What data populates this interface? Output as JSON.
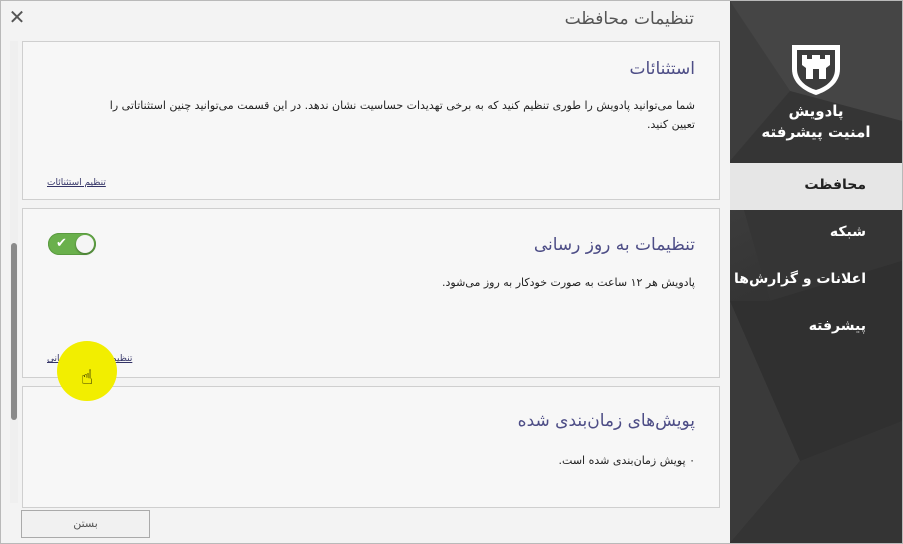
{
  "window": {
    "title": "تنظیمات محافظت",
    "close_glyph": "✕"
  },
  "brand": {
    "line1": "پادویش",
    "line2": "امنیت پیشرفته"
  },
  "nav": {
    "items": [
      {
        "label": "محافظت",
        "active": true
      },
      {
        "label": "شبکه",
        "active": false
      },
      {
        "label": "اعلانات و گزارش‌ها",
        "active": false
      },
      {
        "label": "پیشرفته",
        "active": false
      }
    ]
  },
  "sections": {
    "exceptions": {
      "title": "استثنائات",
      "description": "شما می‌توانید پادویش را طوری تنظیم کنید که به برخی تهدیدات حساسیت نشان ندهد. در این قسمت می‌توانید چنین استثناتاتی را تعیین کنید.",
      "link": "تنظیم استثنائات"
    },
    "updates": {
      "title": "تنظیمات به روز رسانی",
      "description": "پادویش هر ۱۲ ساعت به صورت خودکار به روز می‌شود.",
      "link": "تنظیمات به روز رسانی",
      "toggle_on": true,
      "toggle_check": "✔"
    },
    "scheduled": {
      "title": "پویش‌های زمان‌بندی شده",
      "description": "۰ پویش زمان‌بندی شده است."
    }
  },
  "footer": {
    "close_label": "بستن"
  },
  "cursor": {
    "glyph": "☝"
  },
  "colors": {
    "sidebar_bg": "#3a3a3a",
    "active_nav_bg": "#e6e6e6",
    "panel_title": "#4d4d86",
    "toggle_on": "#6ab04c",
    "cursor_highlight": "#f2ee00"
  }
}
